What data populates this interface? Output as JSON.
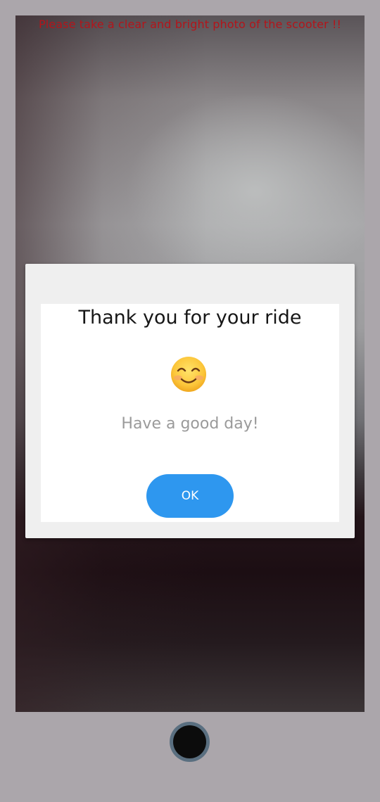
{
  "camera": {
    "instruction": "Please take a clear and bright photo of the scooter !!"
  },
  "dialog": {
    "title": "Thank you for your ride",
    "icon": "smiling-face-icon",
    "message": "Have a good day!",
    "ok_label": "OK"
  },
  "controls": {
    "shutter_icon": "shutter-button"
  },
  "colors": {
    "instruction_text": "#b3151b",
    "ok_button": "#2e97ef",
    "dialog_background": "#efefef",
    "page_frame": "#aba6ab"
  }
}
